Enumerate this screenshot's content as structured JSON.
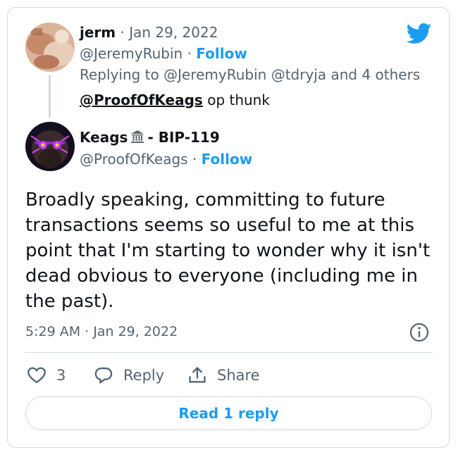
{
  "parent_tweet": {
    "author_name": "jerm",
    "date_sep": " · ",
    "date": "Jan 29, 2022",
    "handle": "@JeremyRubin",
    "follow_sep": " · ",
    "follow_label": "Follow",
    "replying_prefix": "Replying to",
    "replying_targets": "@JeremyRubin @tdryja and 4 others",
    "mention": "@ProofOfKeags",
    "text": "op thunk"
  },
  "main_tweet": {
    "author_name": "Keags",
    "author_suffix": "- BIP-119",
    "handle": "@ProofOfKeags",
    "follow_sep": " · ",
    "follow_label": "Follow",
    "text": "Broadly speaking, committing to future transactions seems so useful to me at this point that I'm starting to wonder why it isn't dead obvious to everyone (including me in the past).",
    "time": "5:29 AM",
    "time_sep": " · ",
    "date": "Jan 29, 2022"
  },
  "actions": {
    "like_count": "3",
    "reply_label": "Reply",
    "share_label": "Share"
  },
  "read_reply_label": "Read 1 reply",
  "icons": {
    "logo": "twitter-bird-icon",
    "author_badge": "bank-building-icon",
    "info": "info-icon",
    "like": "heart-icon",
    "reply": "speech-bubble-icon",
    "share": "share-upload-icon"
  },
  "colors": {
    "accent": "#1d9bf0",
    "text": "#0f1419",
    "muted": "#536471",
    "border": "#cfd9de"
  }
}
